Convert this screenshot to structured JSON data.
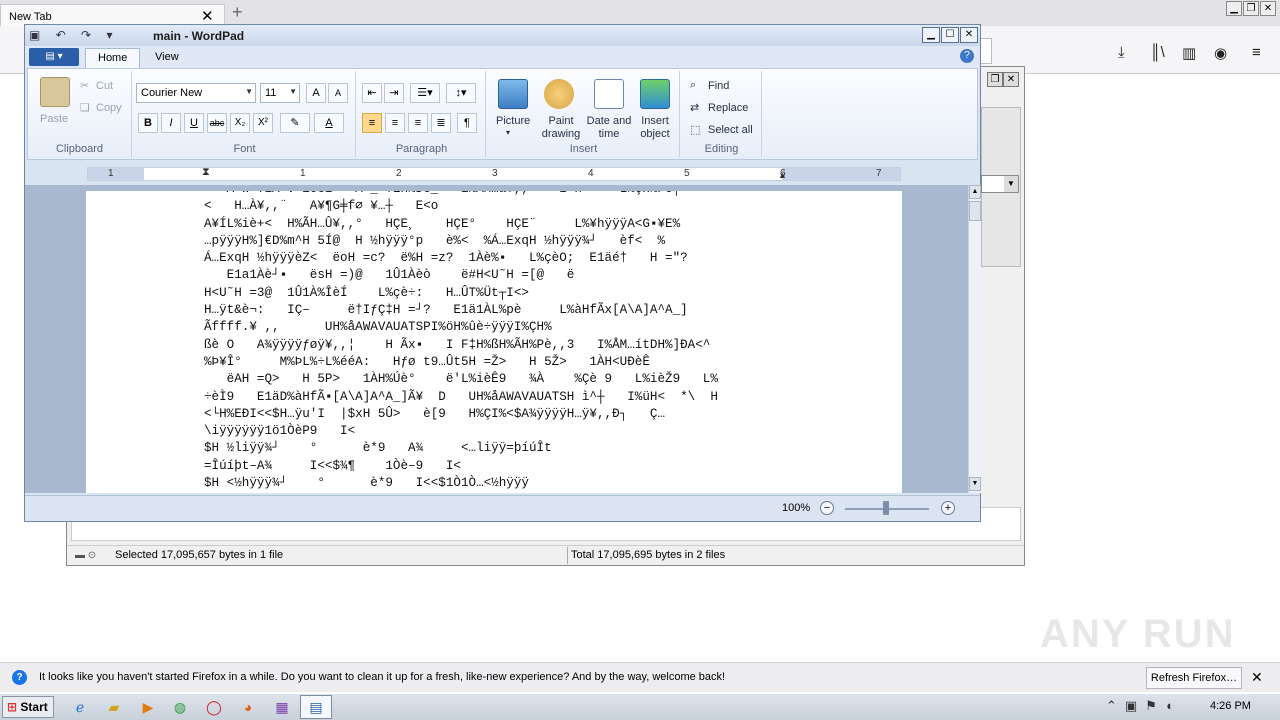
{
  "firefox": {
    "tab_title": "New Tab",
    "tab_close": "✕",
    "new_tab": "+",
    "win_minimize": "▁",
    "win_restore": "❐",
    "win_close": "✕",
    "icons": [
      "download-icon",
      "library-icon",
      "sidebar-icon",
      "account-icon",
      "menu-icon"
    ]
  },
  "wordpad": {
    "title": "main - WordPad",
    "file_button": "▤ ▾",
    "quick_access": "▣ ↶ ↷ ▾",
    "tabs": [
      "Home",
      "View"
    ],
    "help": "?",
    "clipboard": {
      "label": "Clipboard",
      "paste": "Paste",
      "cut": "Cut",
      "copy": "Copy"
    },
    "font": {
      "label": "Font",
      "family": "Courier New",
      "size": "11",
      "grow": "A",
      "shrink": "A",
      "bold": "B",
      "italic": "I",
      "underline": "U",
      "strike": "abc",
      "sub": "X₂",
      "sup": "X²",
      "highlight": "✎",
      "color": "A"
    },
    "paragraph": {
      "label": "Paragraph"
    },
    "insert": {
      "label": "Insert",
      "picture": "Picture",
      "paint": "Paint drawing",
      "datetime": "Date and time",
      "object": "Insert object"
    },
    "editing": {
      "label": "Editing",
      "find": "Find",
      "replace": "Replace",
      "select_all": "Select all"
    },
    "ruler_numbers": [
      "1",
      "1",
      "2",
      "3",
      "4",
      "5",
      "6",
      "7"
    ],
    "document_text": "   A<w-¥ìA-v▪ìOeì~  A<_▪¥EH%Dè_<  ì%AM…a¥,,»   ì<ñ     L%çH%Pè┬\n<   H…À¥,,¨   A¥¶G╪f∅ ¥…┼   E<o\nA¥ÍL%iè+<  H%ÃH…Û¥,,°   HÇE¸    HÇE°    HÇE¨     L%¥hÿÿÿA<G▪¥E%\n…pÿÿÿH%]€D%m^H 5Í@  H ½hÿÿÿ°p   è%<  %Á…ExqH ½hÿÿÿ¾┘   èf<  %\nÁ…ExqH ½hÿÿÿèZ<  ëoH =c?  ë%H =z?  1Àè%▪   L%çèO;  E1äé†   H =\"?\n   E1a1Àè┘▪   ësH =)@   1Û1Àèò    ë#H<U˜H =[@   ë\nH<U˜H =3@  1Û1À%ÎèÍ    L%çè÷:   H…ÛT%Üt┬I<>\nH…ÿt&è¬:   IÇ–     ë†IƒÇ‡H =┘?   E1ä1ÀL%pè     L%àHfÃx[A\\A]A^A_]\nÃffff.¥ ,,      UH%åAWAVAUATSPI%öH%ûè÷ÿÿÿI%ÇH%\nßè O   A¾ÿÿÿÿƒøÿ¥,,¦    H Ãx▪   I F‡H%ßH%ÃH%Pè,,3   I%ÅM…ítDH%]ÐA<^\n%Þ¥Î°     M%ÞL%÷L%ééA:   Hƒø t9…Ût5H =Ž>   H 5Ž>   1ÀH<UÐèÊ\n   ëAH =Q>   H 5P>   1ÀH%Úè°    ë'L%ièÊ9   ¾À    %Çè 9   L%ièŽ9   L%\n÷èÌ9   E1äD%àHfÃ▪[A\\A]A^A_]Ã¥  D   UH%åAWAVAUATSH ì^┼   I%üH<  *\\  H\n<└H%EÐI<<$H…ÿu'I  |$xH 5Û>   è[9   H%ÇI%<$A¾ÿÿÿÿH…ÿ¥,,Ð┐   Ç…\n\\iÿÿÿÿÿÿ1ö1ÒèP9   I<\n$H ½liÿÿ¾┘    °      è*9   A¾     <…liÿÿ=þíúÎt\n=Îúíþt–A¾     I<<$¾¶    1Òè–9   I<\n$H <½hÿÿÿ¾┘    °      è*9   I<<$1Ò1Ò…<½hÿÿÿ",
    "zoom": "100%",
    "zoom_out": "−",
    "zoom_in": "+"
  },
  "archiver": {
    "status_left": "Selected 17,095,657 bytes in 1 file",
    "status_right": "Total 17,095,695 bytes in 2 files"
  },
  "notification": {
    "message": "It looks like you haven't started Firefox in a while. Do you want to clean it up for a fresh, like-new experience? And by the way, welcome back!",
    "button": "Refresh Firefox…",
    "close": "✕"
  },
  "watermark": "ANY RUN",
  "taskbar": {
    "start": "Start",
    "clock": "4:26 PM"
  }
}
